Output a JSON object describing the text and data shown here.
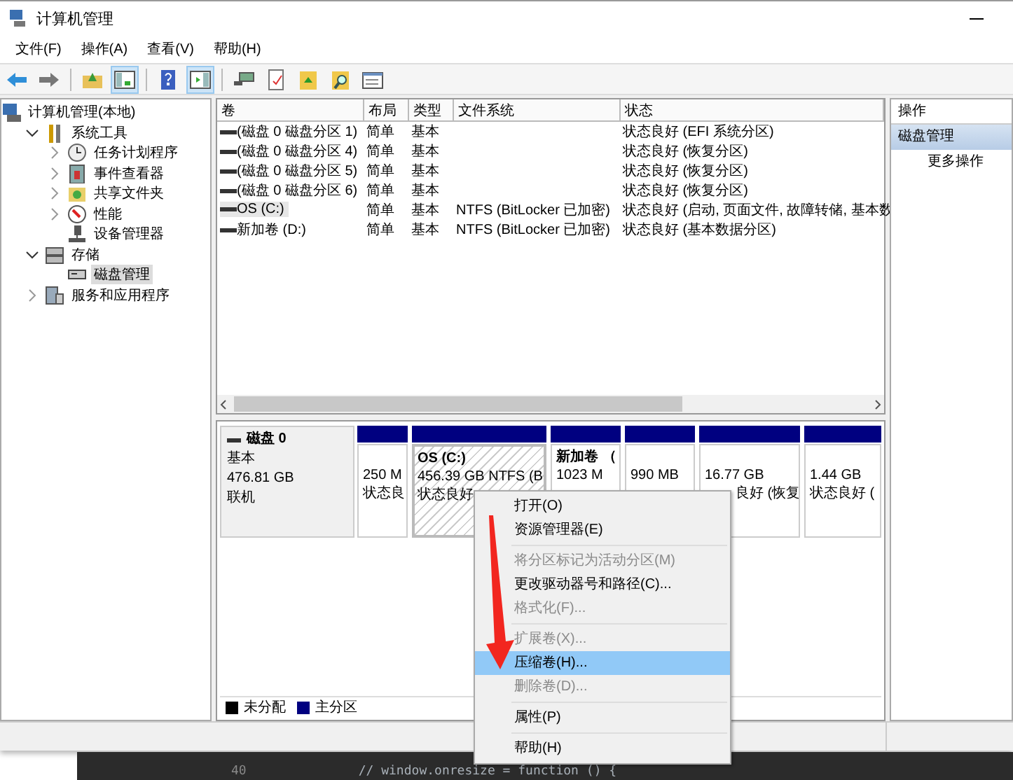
{
  "window": {
    "title": "计算机管理"
  },
  "menu": [
    "文件(F)",
    "操作(A)",
    "查看(V)",
    "帮助(H)"
  ],
  "toolbar": [
    {
      "kind": "back",
      "pressed": false
    },
    {
      "kind": "forward",
      "pressed": false
    },
    {
      "kind": "sep"
    },
    {
      "kind": "up",
      "pressed": false
    },
    {
      "kind": "tree",
      "pressed": true
    },
    {
      "kind": "sep"
    },
    {
      "kind": "help",
      "pressed": false
    },
    {
      "kind": "pane",
      "pressed": true
    },
    {
      "kind": "sep"
    },
    {
      "kind": "connect",
      "pressed": false
    },
    {
      "kind": "doc",
      "pressed": false
    },
    {
      "kind": "folder",
      "pressed": false
    },
    {
      "kind": "find",
      "pressed": false
    },
    {
      "kind": "props",
      "pressed": false
    }
  ],
  "tree": [
    {
      "label": "计算机管理(本地)",
      "selected": false,
      "children": [
        {
          "label": "系统工具",
          "expanded": true,
          "selected": false,
          "children": [
            {
              "label": "任务计划程序",
              "expanded": false,
              "selected": false
            },
            {
              "label": "事件查看器",
              "expanded": false,
              "selected": false
            },
            {
              "label": "共享文件夹",
              "expanded": false,
              "selected": false
            },
            {
              "label": "性能",
              "expanded": false,
              "selected": false
            },
            {
              "label": "设备管理器",
              "selected": false
            }
          ]
        },
        {
          "label": "存储",
          "expanded": true,
          "selected": false,
          "children": [
            {
              "label": "磁盘管理",
              "selected": true
            }
          ]
        },
        {
          "label": "服务和应用程序",
          "expanded": false,
          "selected": false
        }
      ]
    }
  ],
  "table": {
    "columns": [
      "卷",
      "布局",
      "类型",
      "文件系统",
      "状态"
    ],
    "rows": [
      {
        "cells": [
          "(磁盘 0 磁盘分区 1)",
          "简单",
          "基本",
          null,
          "状态良好 (EFI 系统分区)"
        ],
        "selected": false
      },
      {
        "cells": [
          "(磁盘 0 磁盘分区 4)",
          "简单",
          "基本",
          null,
          "状态良好 (恢复分区)"
        ],
        "selected": false
      },
      {
        "cells": [
          "(磁盘 0 磁盘分区 5)",
          "简单",
          "基本",
          null,
          "状态良好 (恢复分区)"
        ],
        "selected": false
      },
      {
        "cells": [
          "(磁盘 0 磁盘分区 6)",
          "简单",
          "基本",
          null,
          "状态良好 (恢复分区)"
        ],
        "selected": false
      },
      {
        "cells": [
          "OS (C:)",
          "简单",
          "基本",
          "NTFS (BitLocker 已加密)",
          "状态良好 (启动, 页面文件, 故障转储, 基本数"
        ],
        "selected": true
      },
      {
        "cells": [
          "新加卷 (D:)",
          "简单",
          "基本",
          "NTFS (BitLocker 已加密)",
          "状态良好 (基本数据分区)"
        ],
        "selected": false
      }
    ]
  },
  "disk": {
    "name": "磁盘 0",
    "type": "基本",
    "size": "476.81 GB",
    "state": "联机",
    "partitions": [
      {
        "size": "250 M",
        "status": "状态良",
        "color": "#000080",
        "selected": false
      },
      {
        "title": "OS  (C:)",
        "size": "456.39 GB NTFS (B",
        "status": "状态良好",
        "color": "#000080",
        "selected": true
      },
      {
        "title": "新加卷 （",
        "size": "1023 M",
        "color": "#000080",
        "selected": false
      },
      {
        "size": "990 MB",
        "color": "#000080",
        "selected": false
      },
      {
        "size": "16.77 GB",
        "status": "良好 (恢复",
        "color": "#000080",
        "selected": false
      },
      {
        "size": "1.44 GB",
        "status": "状态良好 (",
        "color": "#000080",
        "selected": false
      }
    ]
  },
  "legend": [
    {
      "label": "未分配",
      "color": "#000000"
    },
    {
      "label": "主分区",
      "color": "#000080"
    }
  ],
  "actions": {
    "header": "操作",
    "items": [
      {
        "label": "磁盘管理",
        "selected": true
      },
      {
        "label": "更多操作",
        "selected": false
      }
    ]
  },
  "context_menu": [
    {
      "kind": "item",
      "label": "打开(O)",
      "disabled": false,
      "selected": false
    },
    {
      "kind": "item",
      "label": "资源管理器(E)",
      "disabled": false,
      "selected": false
    },
    {
      "kind": "separator"
    },
    {
      "kind": "item",
      "label": "将分区标记为活动分区(M)",
      "disabled": true,
      "selected": false
    },
    {
      "kind": "item",
      "label": "更改驱动器号和路径(C)...",
      "disabled": false,
      "selected": false
    },
    {
      "kind": "item",
      "label": "格式化(F)...",
      "disabled": true,
      "selected": false
    },
    {
      "kind": "separator"
    },
    {
      "kind": "item",
      "label": "扩展卷(X)...",
      "disabled": true,
      "selected": false
    },
    {
      "kind": "item",
      "label": "压缩卷(H)...",
      "disabled": false,
      "selected": true
    },
    {
      "kind": "item",
      "label": "删除卷(D)...",
      "disabled": true,
      "selected": false
    },
    {
      "kind": "separator"
    },
    {
      "kind": "item",
      "label": "属性(P)",
      "disabled": false,
      "selected": false
    },
    {
      "kind": "separator"
    },
    {
      "kind": "item",
      "label": "帮助(H)",
      "disabled": false,
      "selected": false
    }
  ],
  "background_editor": {
    "line_number": "40",
    "code": "// window.onresize = function () {"
  }
}
